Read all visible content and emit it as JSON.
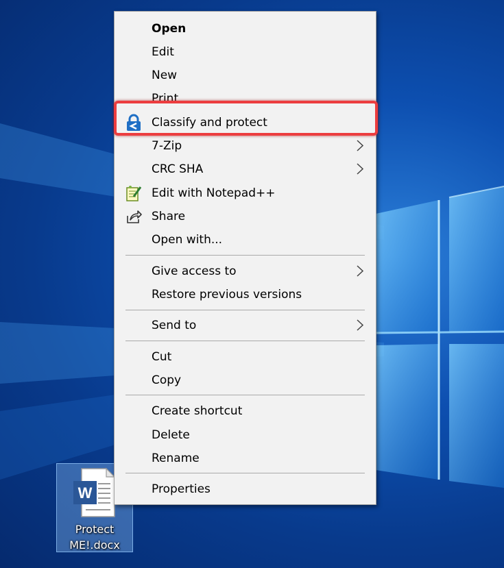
{
  "desktop": {
    "file_icon": {
      "name": "Protect\nME!.docx",
      "icon": "word-document-icon",
      "badge_letter": "W"
    }
  },
  "context_menu": {
    "items": [
      {
        "label": "Open",
        "bold": true
      },
      {
        "label": "Edit"
      },
      {
        "label": "New"
      },
      {
        "label": "Print"
      },
      {
        "label": "Classify and protect",
        "icon": "azure-information-protection-icon",
        "highlighted": true
      },
      {
        "label": "7-Zip",
        "submenu": true
      },
      {
        "label": "CRC SHA",
        "submenu": true
      },
      {
        "label": "Edit with Notepad++",
        "icon": "notepad-plus-plus-icon"
      },
      {
        "label": "Share",
        "icon": "share-icon"
      },
      {
        "label": "Open with..."
      },
      {
        "label": "Give access to",
        "submenu": true
      },
      {
        "label": "Restore previous versions"
      },
      {
        "label": "Send to",
        "submenu": true
      },
      {
        "label": "Cut"
      },
      {
        "label": "Copy"
      },
      {
        "label": "Create shortcut"
      },
      {
        "label": "Delete"
      },
      {
        "label": "Rename"
      },
      {
        "label": "Properties"
      }
    ]
  },
  "colors": {
    "menu_background": "#f2f2f2",
    "highlight_border": "#ec3d3f",
    "desktop_blue": "#0d4fb0",
    "protect_icon_blue": "#1f6fc5",
    "word_blue": "#2b5797"
  }
}
